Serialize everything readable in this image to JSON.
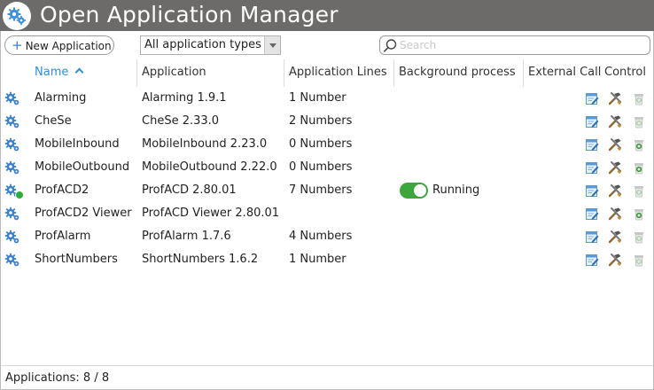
{
  "window": {
    "title": "Open Application Manager",
    "logo_icon": "gear-cluster-icon"
  },
  "toolbar": {
    "new_button_label": "New Application",
    "type_filter": {
      "selected": "All application types"
    },
    "search": {
      "placeholder": "Search",
      "value": ""
    }
  },
  "table": {
    "columns": [
      "Name",
      "Application",
      "Application Lines",
      "Background process",
      "External Call",
      "Control"
    ],
    "sort_column": "Name",
    "sort_direction": "ascending",
    "rows": [
      {
        "name": "Alarming",
        "application": "Alarming 1.9.1",
        "lines": "1 Number",
        "background": "",
        "running": false,
        "delete_active": false
      },
      {
        "name": "CheSe",
        "application": "CheSe 2.33.0",
        "lines": "2 Numbers",
        "background": "",
        "running": false,
        "delete_active": false
      },
      {
        "name": "MobileInbound",
        "application": "MobileInbound 2.23.0",
        "lines": "0 Numbers",
        "background": "",
        "running": false,
        "delete_active": true
      },
      {
        "name": "MobileOutbound",
        "application": "MobileOutbound 2.22.0",
        "lines": "0 Numbers",
        "background": "",
        "running": false,
        "delete_active": true
      },
      {
        "name": "ProfACD2",
        "application": "ProfACD 2.80.01",
        "lines": "7 Numbers",
        "background": "Running",
        "running": true,
        "delete_active": false
      },
      {
        "name": "ProfACD2 Viewer",
        "application": "ProfACD Viewer 2.80.01",
        "lines": "",
        "background": "",
        "running": false,
        "delete_active": true
      },
      {
        "name": "ProfAlarm",
        "application": "ProfAlarm 1.7.6",
        "lines": "4 Numbers",
        "background": "",
        "running": false,
        "delete_active": false
      },
      {
        "name": "ShortNumbers",
        "application": "ShortNumbers 1.6.2",
        "lines": "1 Number",
        "background": "",
        "running": false,
        "delete_active": false
      }
    ]
  },
  "footer": {
    "summary": "Applications: 8 / 8"
  },
  "colors": {
    "titlebar": "#6d6b69",
    "accent": "#2f8fd0",
    "running_green": "#3da63d",
    "status_dot": "#2faa3c"
  }
}
